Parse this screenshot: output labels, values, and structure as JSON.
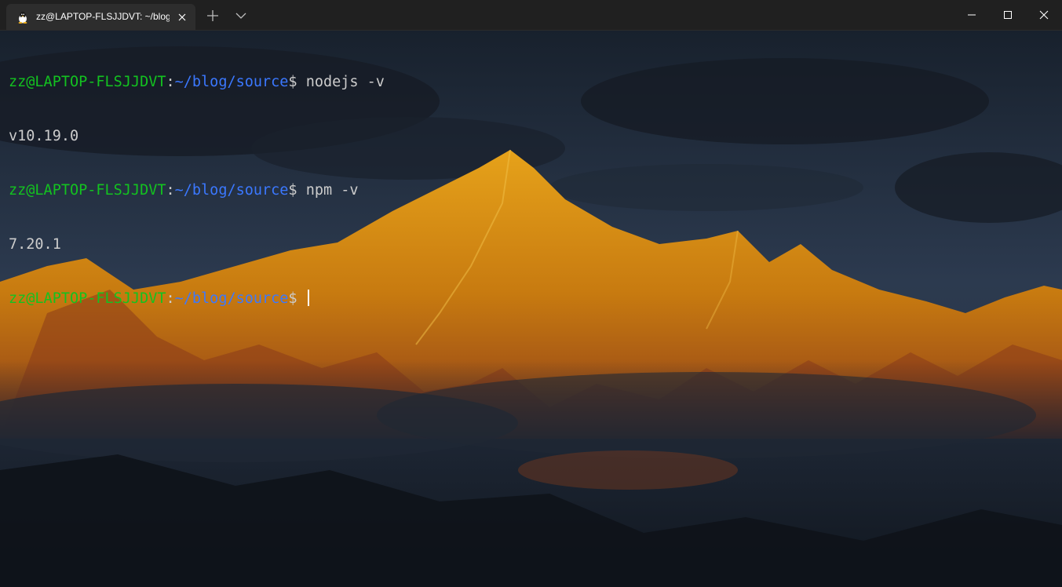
{
  "window": {
    "tab_title": "zz@LAPTOP-FLSJJDVT: ~/blog/s",
    "tab_icon": "linux-tux-icon",
    "new_tab_icon": "plus-icon",
    "dropdown_icon": "chevron-down-icon",
    "minimize_icon": "minimize-icon",
    "maximize_icon": "maximize-icon",
    "close_icon": "close-icon"
  },
  "terminal": {
    "colors": {
      "user": "#13c220",
      "path": "#3b78ff",
      "text": "#cccccc",
      "cursor": "#ffffff"
    },
    "lines": [
      {
        "type": "prompt",
        "user": "zz@LAPTOP-FLSJJDVT",
        "colon": ":",
        "path": "~/blog/source",
        "dollar": "$",
        "command": " nodejs -v"
      },
      {
        "type": "output",
        "text": "v10.19.0"
      },
      {
        "type": "prompt",
        "user": "zz@LAPTOP-FLSJJDVT",
        "colon": ":",
        "path": "~/blog/source",
        "dollar": "$",
        "command": " npm -v"
      },
      {
        "type": "output",
        "text": "7.20.1"
      },
      {
        "type": "prompt",
        "user": "zz@LAPTOP-FLSJJDVT",
        "colon": ":",
        "path": "~/blog/source",
        "dollar": "$",
        "command": " "
      }
    ]
  },
  "background": {
    "description_icon": "mountain-sunset-wallpaper",
    "colors": {
      "sky_top": "#18212d",
      "sky_bottom": "#2c3a4f",
      "mountain_lit": "#d98a12",
      "mountain_shadow": "#8a3a1a",
      "foreground": "#121820"
    }
  }
}
